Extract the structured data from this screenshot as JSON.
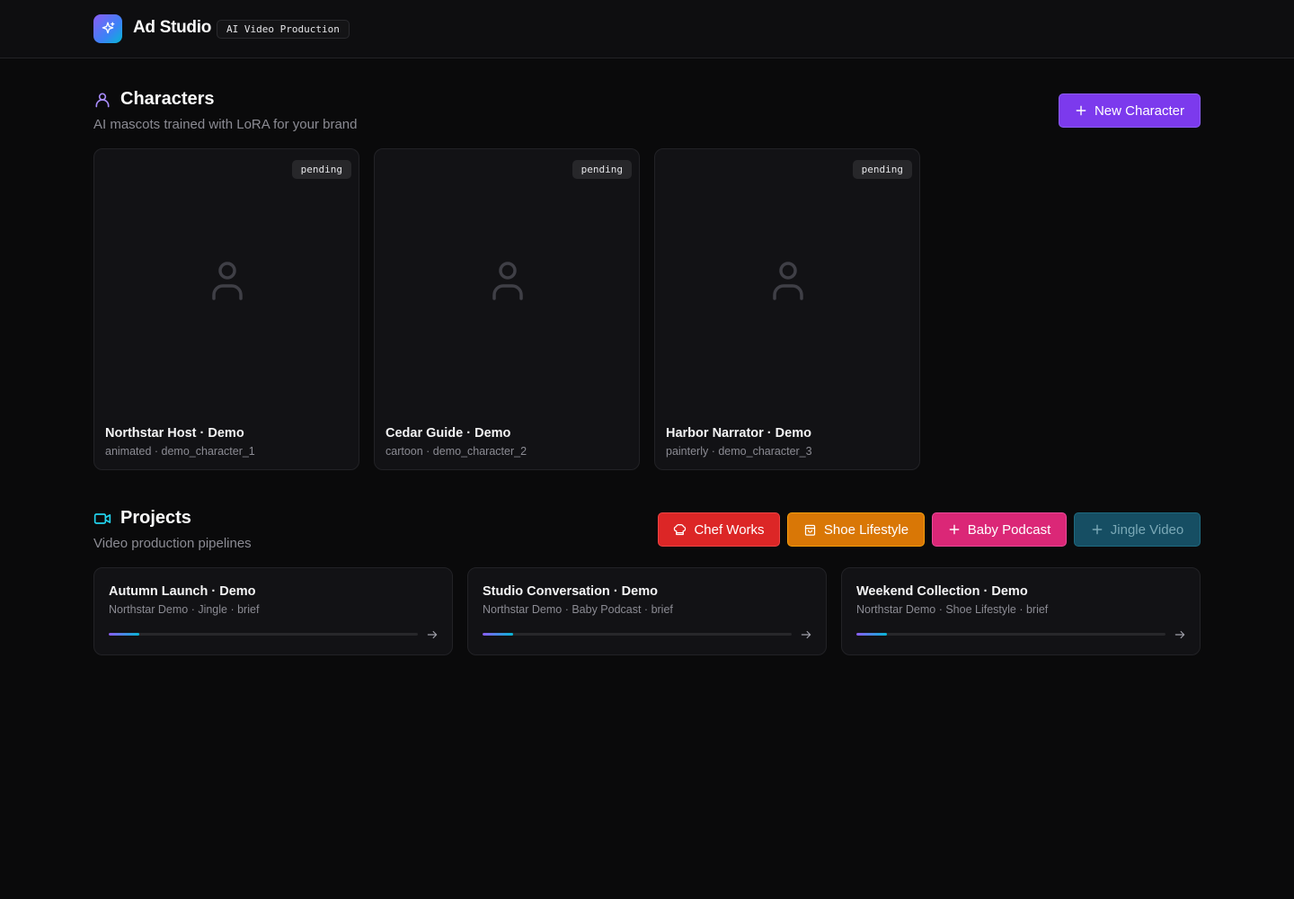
{
  "header": {
    "brand": "Ad Studio",
    "tag": "AI Video Production"
  },
  "characters": {
    "title": "Characters",
    "subtitle": "AI mascots trained with LoRA for your brand",
    "new_button": "New Character",
    "items": [
      {
        "badge": "pending",
        "name": "Northstar Host · Demo",
        "meta": "animated · demo_character_1"
      },
      {
        "badge": "pending",
        "name": "Cedar Guide · Demo",
        "meta": "cartoon · demo_character_2"
      },
      {
        "badge": "pending",
        "name": "Harbor Narrator · Demo",
        "meta": "painterly · demo_character_3"
      }
    ]
  },
  "projects": {
    "title": "Projects",
    "subtitle": "Video production pipelines",
    "templates": [
      {
        "label": "Chef Works",
        "icon": "chef-hat-icon",
        "color": "#dc2626"
      },
      {
        "label": "Shoe Lifestyle",
        "icon": "shopping-bag-icon",
        "color": "#d97706"
      },
      {
        "label": "Baby Podcast",
        "icon": "plus-icon",
        "color": "#db2777"
      },
      {
        "label": "Jingle Video",
        "icon": "plus-icon",
        "color": "#164e63"
      }
    ],
    "items": [
      {
        "name": "Autumn Launch · Demo",
        "meta": "Northstar Demo · Jingle · brief",
        "progress": 0.1
      },
      {
        "name": "Studio Conversation · Demo",
        "meta": "Northstar Demo · Baby Podcast · brief",
        "progress": 0.1
      },
      {
        "name": "Weekend Collection · Demo",
        "meta": "Northstar Demo · Shoe Lifestyle · brief",
        "progress": 0.1
      }
    ]
  }
}
